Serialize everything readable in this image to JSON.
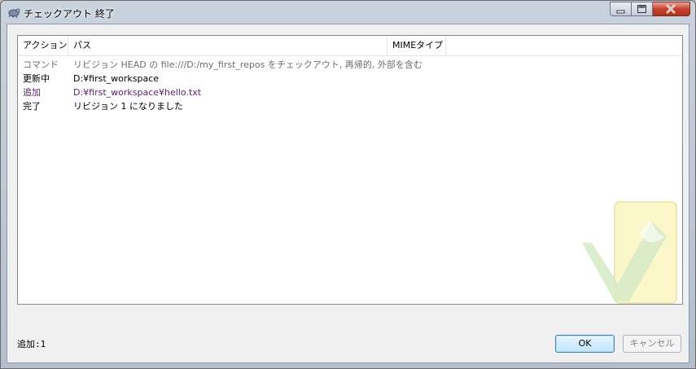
{
  "window": {
    "title": "チェックアウト 終了"
  },
  "columns": [
    {
      "label": "アクション"
    },
    {
      "label": "パス"
    },
    {
      "label": "MIMEタイプ"
    }
  ],
  "rows": [
    {
      "action": "コマンド",
      "path": "リビジョン HEAD の file:///D:/my_first_repos をチェックアウト, 再帰的, 外部を含む",
      "color": "#6d6d6d"
    },
    {
      "action": "更新中",
      "path": "D:¥first_workspace",
      "color": "#000000"
    },
    {
      "action": "追加",
      "path": "D:¥first_workspace¥hello.txt",
      "color": "#5c1e6e"
    },
    {
      "action": "完了",
      "path": "リビジョン 1 になりました",
      "color": "#000000"
    }
  ],
  "status": {
    "summary": "追加:1"
  },
  "buttons": {
    "ok": "OK",
    "cancel": "キャンセル"
  },
  "icons": {
    "app": "tortoise-icon",
    "minimize": "minimize-icon",
    "maximize": "maximize-icon",
    "close": "close-icon",
    "watermark": "checkmark-icon"
  }
}
